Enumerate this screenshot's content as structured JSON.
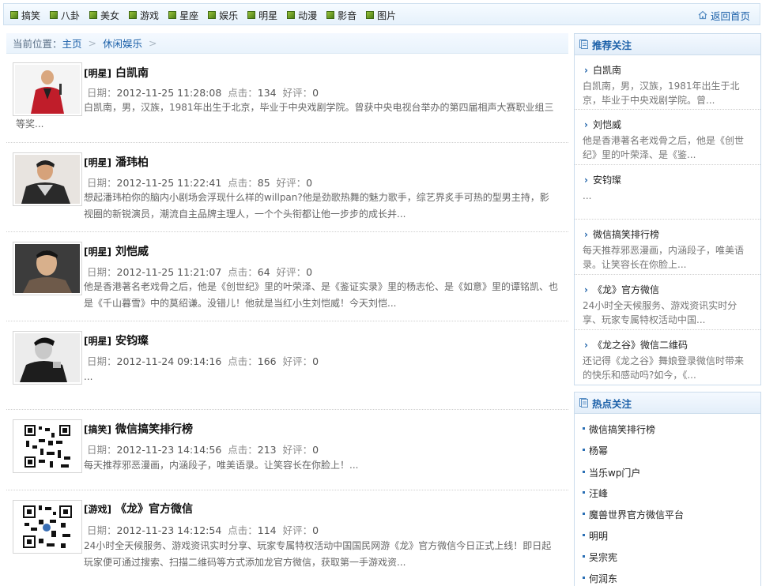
{
  "topnav": {
    "categories": [
      "搞笑",
      "八卦",
      "美女",
      "游戏",
      "星座",
      "娱乐",
      "明星",
      "动漫",
      "影音",
      "图片"
    ],
    "home_label": "返回首页"
  },
  "breadcrumb": {
    "prefix": "当前位置：",
    "home": "主页",
    "section": "休闲娱乐",
    "sep": ">"
  },
  "articles": [
    {
      "tag": "明星",
      "title": "白凯南",
      "date_label": "日期：",
      "date": "2012-11-25 11:28:08",
      "clicks_label": "点击：",
      "clicks": "134",
      "reviews_label": "好评：",
      "reviews": "0",
      "desc": "白凯南，男，汉族，1981年出生于北京，毕业于中央戏剧学院。曾获中央电视台举办的第四届相声大赛职业组三等奖..."
    },
    {
      "tag": "明星",
      "title": "潘玮柏",
      "date_label": "日期：",
      "date": "2012-11-25 11:22:41",
      "clicks_label": "点击：",
      "clicks": "85",
      "reviews_label": "好评：",
      "reviews": "0",
      "desc": "想起潘玮柏你的脑内小剧场会浮现什么样的willpan?他是劲歌热舞的魅力歌手，综艺界炙手可热的型男主持，影视圈的新锐演员，潮流自主品牌主理人，一个个头衔都让他一步步的成长并..."
    },
    {
      "tag": "明星",
      "title": "刘恺威",
      "date_label": "日期：",
      "date": "2012-11-25 11:21:07",
      "clicks_label": "点击：",
      "clicks": "64",
      "reviews_label": "好评：",
      "reviews": "0",
      "desc": "他是香港著名老戏骨之后，他是《创世纪》里的叶荣泽、是《鉴证实录》里的杨志伦、是《如意》里的谭铭凯、也是《千山暮雪》中的莫绍谦。没错儿！他就是当红小生刘恺威！今天刘恺..."
    },
    {
      "tag": "明星",
      "title": "安钧璨",
      "date_label": "日期：",
      "date": "2012-11-24 09:14:16",
      "clicks_label": "点击：",
      "clicks": "166",
      "reviews_label": "好评：",
      "reviews": "0",
      "desc": "..."
    },
    {
      "tag": "搞笑",
      "title": "微信搞笑排行榜",
      "date_label": "日期：",
      "date": "2012-11-23 14:14:56",
      "clicks_label": "点击：",
      "clicks": "213",
      "reviews_label": "好评：",
      "reviews": "0",
      "desc": "每天推荐邪恶漫画，内涵段子，唯美语录。让笑容长在你脸上！..."
    },
    {
      "tag": "游戏",
      "title": "《龙》官方微信",
      "date_label": "日期：",
      "date": "2012-11-23 14:12:54",
      "clicks_label": "点击：",
      "clicks": "114",
      "reviews_label": "好评：",
      "reviews": "0",
      "desc": "24小时全天候服务、游戏资讯实时分享、玩家专属特权活动中国国民网游《龙》官方微信今日正式上线！即日起玩家便可通过搜索、扫描二维码等方式添加龙官方微信，获取第一手游戏资..."
    }
  ],
  "recommend": {
    "title": "推荐关注",
    "items": [
      {
        "title": "白凯南",
        "desc": "白凯南，男，汉族，1981年出生于北京，毕业于中央戏剧学院。曾..."
      },
      {
        "title": "刘恺威",
        "desc": "他是香港著名老戏骨之后，他是《创世纪》里的叶荣泽、是《鉴..."
      },
      {
        "title": "安钧璨",
        "desc": "..."
      },
      {
        "title": "微信搞笑排行榜",
        "desc": "每天推荐邪恶漫画，内涵段子，唯美语录。让笑容长在你脸上..."
      },
      {
        "title": "《龙》官方微信",
        "desc": "24小时全天候服务、游戏资讯实时分享、玩家专属特权活动中国..."
      },
      {
        "title": "《龙之谷》微信二维码",
        "desc": "还记得《龙之谷》舞娘登录微信时带来的快乐和感动吗?如今，《..."
      }
    ]
  },
  "hot": {
    "title": "热点关注",
    "items": [
      "微信搞笑排行榜",
      "杨幂",
      "当乐wp门户",
      "汪峰",
      "魔兽世界官方微信平台",
      "明明",
      "吴宗宪",
      "何润东"
    ]
  },
  "colors": {
    "link": "#1a5fa8",
    "accent_green": "#6fa21f",
    "border": "#cbdcec"
  }
}
